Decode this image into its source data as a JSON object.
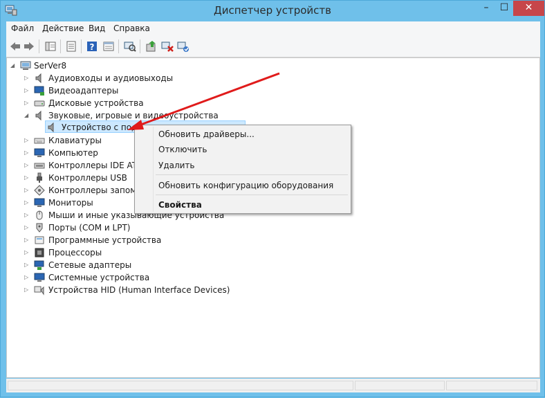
{
  "window": {
    "title": "Диспетчер устройств",
    "minimize": "–",
    "maximize": "☐",
    "close": "✕"
  },
  "menubar": {
    "items": [
      "Файл",
      "Действие",
      "Вид",
      "Справка"
    ]
  },
  "tree": {
    "root": "SerVer8",
    "categories": [
      "Аудиовходы и аудиовыходы",
      "Видеоадаптеры",
      "Дисковые устройства",
      "Звуковые, игровые и видеоустройства",
      "Устройство с подде",
      "Клавиатуры",
      "Компьютер",
      "Контроллеры IDE ATA",
      "Контроллеры USB",
      "Контроллеры запоми",
      "Мониторы",
      "Мыши и иные указывающие устройства",
      "Порты (COM и LPT)",
      "Программные устройства",
      "Процессоры",
      "Сетевые адаптеры",
      "Системные устройства",
      "Устройства HID (Human Interface Devices)"
    ]
  },
  "context_menu": {
    "update_drivers": "Обновить драйверы...",
    "disable": "Отключить",
    "uninstall": "Удалить",
    "scan_hardware": "Обновить конфигурацию оборудования",
    "properties": "Свойства"
  },
  "colors": {
    "titlebar": "#6fc0ea",
    "close_button": "#c7464a",
    "selection": "#cce8ff",
    "annotation_arrow": "#e01b1b"
  }
}
